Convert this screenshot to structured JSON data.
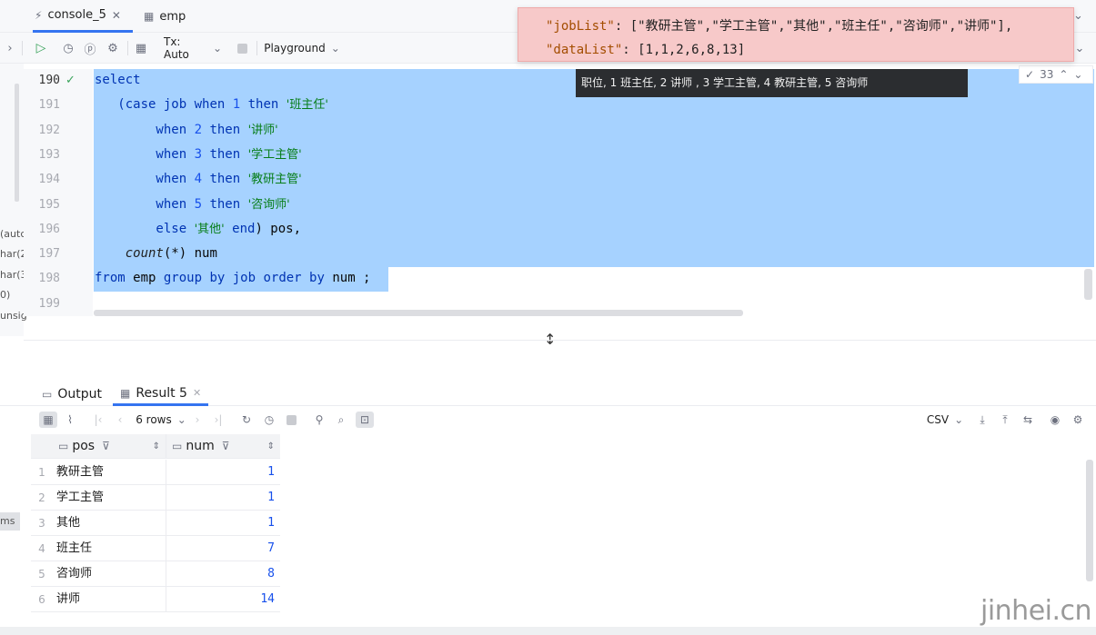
{
  "tabs": [
    {
      "label": "console_5",
      "icon": "console-icon"
    },
    {
      "label": "emp",
      "icon": "table-icon"
    }
  ],
  "toolbar": {
    "tx_label": "Tx: Auto",
    "playground_label": "Playground"
  },
  "left_labels": [
    "(autc",
    "har(2",
    "har(3.",
    "0)",
    "unsig"
  ],
  "editor": {
    "line_numbers": [
      "190",
      "191",
      "192",
      "193",
      "194",
      "195",
      "196",
      "197",
      "198",
      "199"
    ],
    "lines": [
      {
        "tokens": [
          {
            "t": "select",
            "c": "kw"
          }
        ]
      },
      {
        "tokens": [
          {
            "t": "   (case ",
            "c": "kw"
          },
          {
            "t": "job",
            "c": "kw"
          },
          {
            "t": " when ",
            "c": "kw"
          },
          {
            "t": "1",
            "c": "num"
          },
          {
            "t": " then ",
            "c": "kw"
          },
          {
            "t": "'班主任'",
            "c": "str"
          }
        ]
      },
      {
        "tokens": [
          {
            "t": "        when ",
            "c": "kw"
          },
          {
            "t": "2",
            "c": "num"
          },
          {
            "t": " then ",
            "c": "kw"
          },
          {
            "t": "'讲师'",
            "c": "str"
          }
        ]
      },
      {
        "tokens": [
          {
            "t": "        when ",
            "c": "kw"
          },
          {
            "t": "3",
            "c": "num"
          },
          {
            "t": " then ",
            "c": "kw"
          },
          {
            "t": "'学工主管'",
            "c": "str"
          }
        ]
      },
      {
        "tokens": [
          {
            "t": "        when ",
            "c": "kw"
          },
          {
            "t": "4",
            "c": "num"
          },
          {
            "t": " then ",
            "c": "kw"
          },
          {
            "t": "'教研主管'",
            "c": "str"
          }
        ]
      },
      {
        "tokens": [
          {
            "t": "        when ",
            "c": "kw"
          },
          {
            "t": "5",
            "c": "num"
          },
          {
            "t": " then ",
            "c": "kw"
          },
          {
            "t": "'咨询师'",
            "c": "str"
          }
        ]
      },
      {
        "tokens": [
          {
            "t": "        else ",
            "c": "kw"
          },
          {
            "t": "'其他'",
            "c": "str"
          },
          {
            "t": " end",
            "c": "kw"
          },
          {
            "t": ") pos,",
            "c": "plain"
          }
        ]
      },
      {
        "tokens": [
          {
            "t": "    ",
            "c": "plain"
          },
          {
            "t": "count",
            "c": "fn"
          },
          {
            "t": "(*) num",
            "c": "plain"
          }
        ]
      },
      {
        "tokens": [
          {
            "t": "from",
            "c": "kw"
          },
          {
            "t": " emp ",
            "c": "plain"
          },
          {
            "t": "group by",
            "c": "kw"
          },
          {
            "t": " job ",
            "c": "kw"
          },
          {
            "t": "order by",
            "c": "kw"
          },
          {
            "t": " num ;",
            "c": "plain"
          }
        ]
      },
      {
        "tokens": []
      }
    ],
    "inspection_count": "33"
  },
  "json_popup": {
    "line1_key": "\"jobList\"",
    "line1_val": ": [\"教研主管\",\"学工主管\",\"其他\",\"班主任\",\"咨询师\",\"讲师\"],",
    "line2_key": "\"dataList\"",
    "line2_val": ": [1,1,2,6,8,13]"
  },
  "tooltip": "职位, 1 班主任, 2 讲师 , 3 学工主管, 4 教研主管, 5 咨询师",
  "results": {
    "tabs": [
      {
        "label": "Output"
      },
      {
        "label": "Result 5"
      }
    ],
    "rows_label": "6 rows",
    "export_label": "CSV",
    "columns": [
      "pos",
      "num"
    ],
    "rows": [
      {
        "n": "1",
        "pos": "教研主管",
        "num": "1"
      },
      {
        "n": "2",
        "pos": "学工主管",
        "num": "1"
      },
      {
        "n": "3",
        "pos": "其他",
        "num": "1"
      },
      {
        "n": "4",
        "pos": "班主任",
        "num": "7"
      },
      {
        "n": "5",
        "pos": "咨询师",
        "num": "8"
      },
      {
        "n": "6",
        "pos": "讲师",
        "num": "14"
      }
    ],
    "side_tab": "ms"
  },
  "watermark": "jinhei.cn"
}
